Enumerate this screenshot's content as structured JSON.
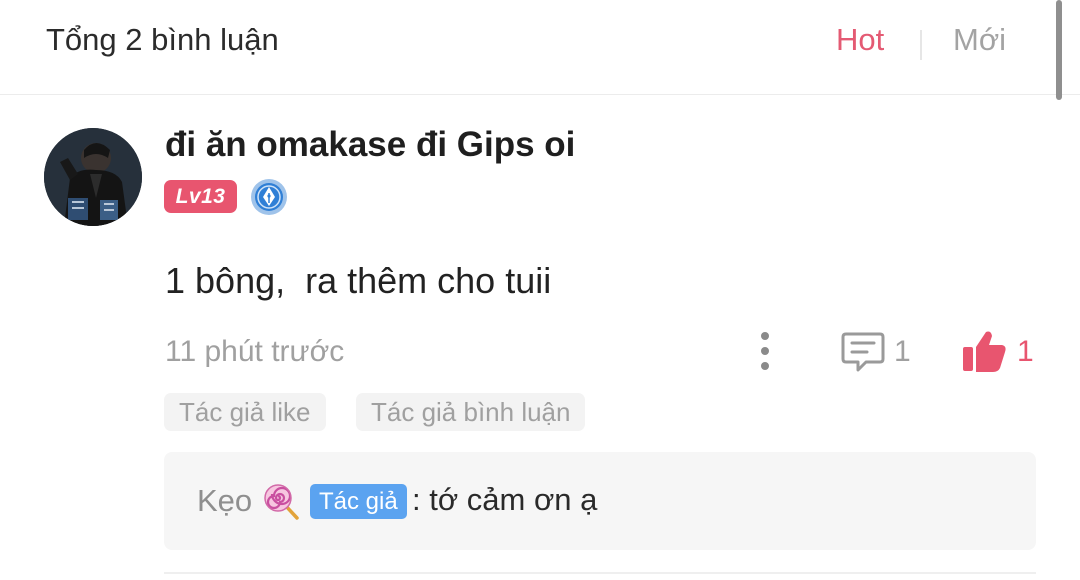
{
  "header": {
    "title": "Tổng 2 bình luận",
    "sort_hot": "Hot",
    "sort_new": "Mới"
  },
  "comment": {
    "username": "đi ăn omakase đi Gips oi",
    "level": "Lv13",
    "medal_icon": "pen-nib-medal-icon",
    "text": "1 bông,  ra thêm cho tuii",
    "timestamp": "11 phút trước",
    "reply_count": "1",
    "like_count": "1",
    "tags": [
      "Tác giả like",
      "Tác giả bình luận"
    ]
  },
  "reply_preview": {
    "author": "Kẹo",
    "author_emoji": "lollipop-icon",
    "author_badge": "Tác giả",
    "text": ": tớ cảm ơn ạ"
  },
  "colors": {
    "accent": "#e45a73",
    "level_badge": "#e8556f",
    "author_badge": "#5ba3f0",
    "muted_text": "#a0a0a0"
  }
}
